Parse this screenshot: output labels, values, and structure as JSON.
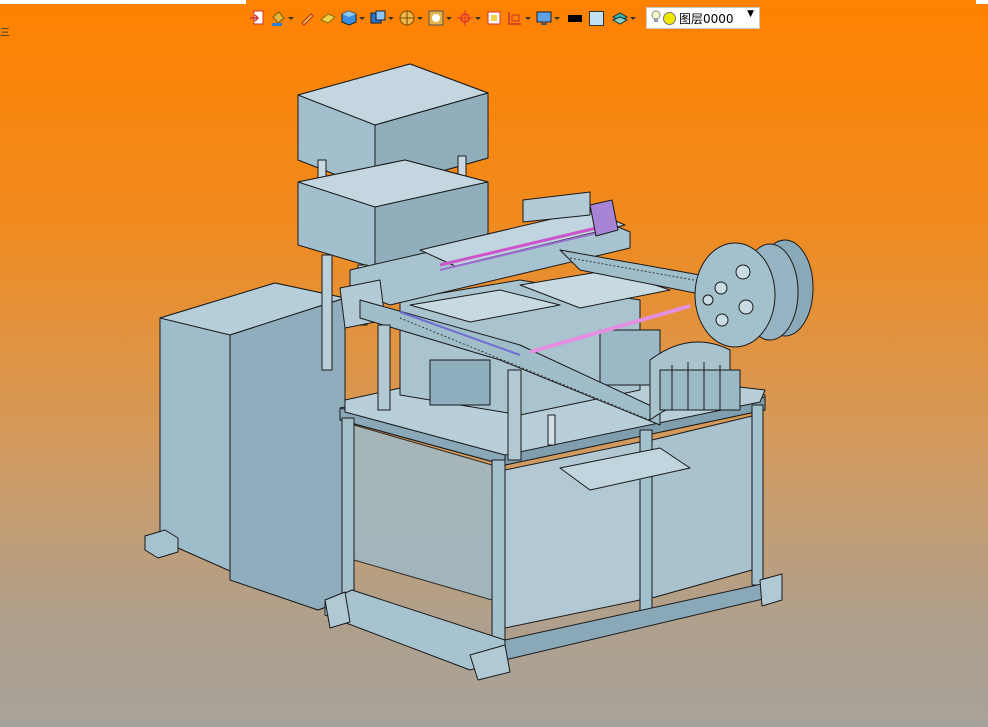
{
  "toolbar": {
    "buttons": [
      {
        "icon": "exit-icon",
        "has_dropdown": false
      },
      {
        "icon": "paint-bucket-icon",
        "has_dropdown": true
      },
      {
        "icon": "pencil-icon",
        "has_dropdown": false
      },
      {
        "icon": "eraser-icon",
        "has_dropdown": false
      },
      {
        "icon": "cube-icon",
        "has_dropdown": true
      },
      {
        "icon": "view-cube-icon",
        "has_dropdown": true
      },
      {
        "icon": "section-icon",
        "has_dropdown": true
      },
      {
        "icon": "render-icon",
        "has_dropdown": true
      },
      {
        "icon": "axis-icon",
        "has_dropdown": true
      },
      {
        "icon": "frame-icon",
        "has_dropdown": false
      },
      {
        "icon": "dimension-icon",
        "has_dropdown": true
      },
      {
        "icon": "display-icon",
        "has_dropdown": true
      }
    ],
    "line_color": "#000000",
    "fill_color": "#bfe3f5",
    "layer": {
      "name": "图层0000",
      "state_color": "#f1e800"
    }
  },
  "viewport": {
    "background_top": "#ff8200",
    "background_bottom": "#a8a39a",
    "model_color": "#9ab8c6"
  },
  "edge_text": "三"
}
